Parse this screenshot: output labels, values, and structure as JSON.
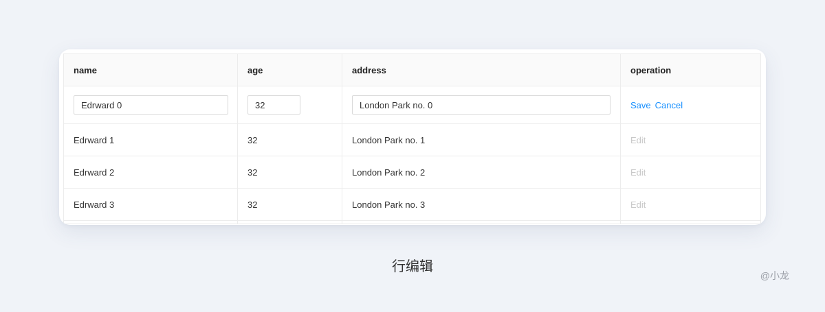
{
  "table": {
    "columns": [
      "name",
      "age",
      "address",
      "operation"
    ],
    "edit_row": {
      "name": "Edrward 0",
      "age": "32",
      "address": "London Park no. 0",
      "save_label": "Save",
      "cancel_label": "Cancel"
    },
    "rows": [
      {
        "name": "Edrward 1",
        "age": "32",
        "address": "London Park no. 1",
        "action": "Edit"
      },
      {
        "name": "Edrward 2",
        "age": "32",
        "address": "London Park no. 2",
        "action": "Edit"
      },
      {
        "name": "Edrward 3",
        "age": "32",
        "address": "London Park no. 3",
        "action": "Edit"
      }
    ]
  },
  "caption": "行编辑",
  "watermark": "@小龙",
  "colors": {
    "link": "#1890ff",
    "disabled_link": "#c8c8c8",
    "background": "#f0f3f8"
  }
}
